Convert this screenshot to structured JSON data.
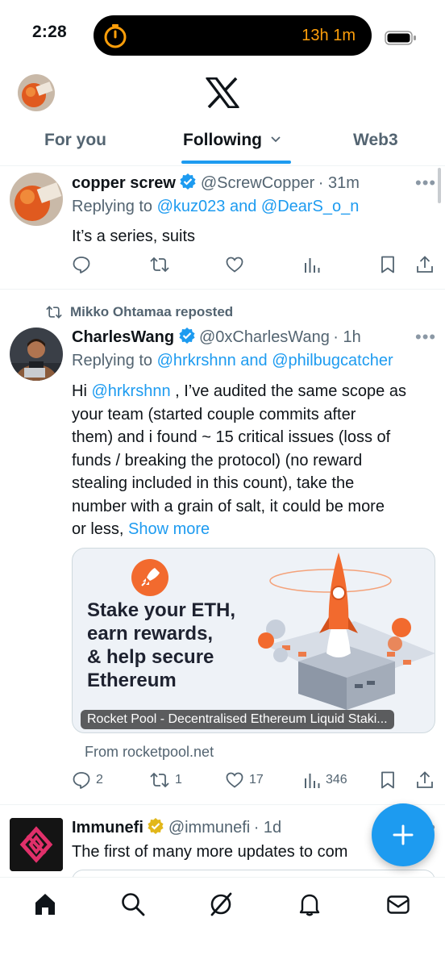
{
  "status_bar": {
    "time": "2:28",
    "timer_text": "13h 1m"
  },
  "header": {
    "logo": "x-logo-icon"
  },
  "tabs": [
    {
      "label": "For you"
    },
    {
      "label": "Following"
    },
    {
      "label": "Web3"
    }
  ],
  "tweets": [
    {
      "name": "copper screw",
      "handle": "@ScrewCopper",
      "time": "· 31m",
      "replying_prefix": "Replying to",
      "replying_users": "@kuz023 and @DearS_o_n",
      "text": "It’s a series, suits"
    },
    {
      "repost_label": "Mikko Ohtamaa reposted",
      "name": "CharlesWang",
      "handle": "@0xCharlesWang",
      "time": "· 1h",
      "replying_prefix": "Replying to",
      "replying_users": "@hrkrshnn and @philbugcatcher",
      "text_mention": "@hrkrshnn",
      "text_lines": [
        "Hi ",
        " , I’ve audited the same scope as",
        "your team (started couple commits after",
        "them) and i  found ~ 15 critical issues (loss of",
        "funds / breaking the protocol) (no reward",
        "stealing included in this count), take the",
        "number with a grain of salt, it could be more",
        "or less, "
      ],
      "show_more": "Show more",
      "card": {
        "headline_lines": [
          "Stake your ETH,",
          "earn rewards,",
          "& help secure",
          "Ethereum"
        ],
        "label": "Rocket Pool - Decentralised Ethereum Liquid Staki...",
        "from": "From rocketpool.net"
      },
      "counts": {
        "replies": "2",
        "reposts": "1",
        "likes": "17",
        "views": "346"
      }
    },
    {
      "name": "Immunefi",
      "handle": "@immunefi",
      "time": "· 1d",
      "text": "The first of many more updates to com"
    }
  ],
  "colors": {
    "accent": "#1d9bf0",
    "text": "#0f1419",
    "muted": "#536471",
    "timer": "#ff9f0a",
    "card_accent": "#f26a2e"
  }
}
